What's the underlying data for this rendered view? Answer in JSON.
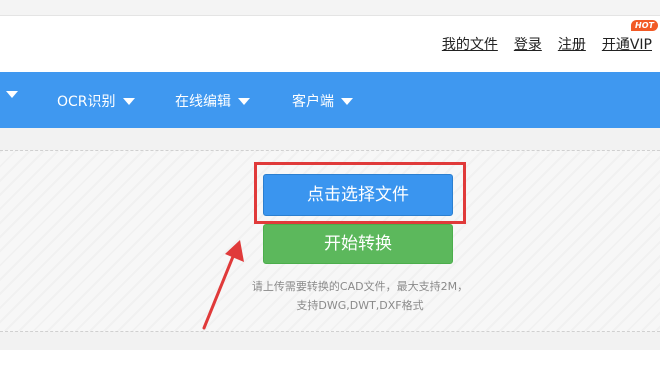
{
  "header": {
    "links": [
      {
        "label": "我的文件"
      },
      {
        "label": "登录"
      },
      {
        "label": "注册"
      },
      {
        "label": "开通VIP"
      }
    ],
    "hot_badge": "HOT"
  },
  "nav": {
    "items": [
      {
        "label": "OCR识别"
      },
      {
        "label": "在线编辑"
      },
      {
        "label": "客户端"
      }
    ]
  },
  "upload": {
    "select_button": "点击选择文件",
    "start_button": "开始转换",
    "hint_line1": "请上传需要转换的CAD文件，最大支持2M，",
    "hint_line2": "支持DWG,DWT,DXF格式"
  },
  "colors": {
    "nav_blue": "#3f98f0",
    "select_blue": "#3a95ef",
    "start_green": "#5cb85c",
    "highlight_red": "#e03a3a",
    "hot_orange": "#f25a26"
  }
}
